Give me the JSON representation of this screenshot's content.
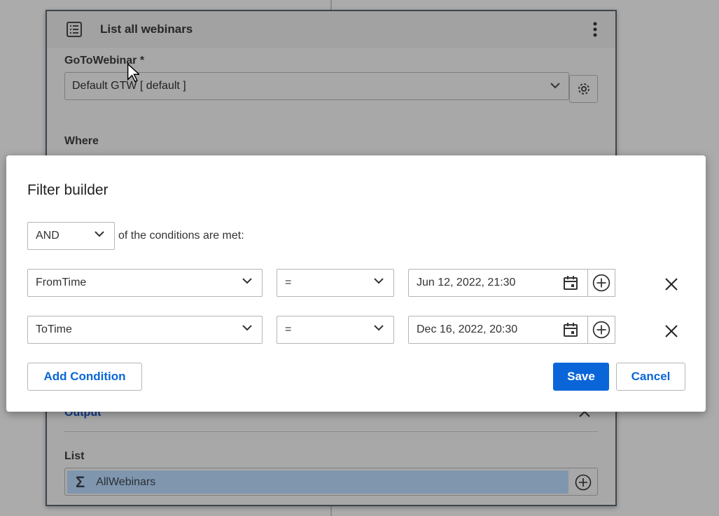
{
  "card": {
    "title": "List all webinars",
    "gtw_label": "GoToWebinar *",
    "gtw_value": "Default GTW [ default ]",
    "where_label": "Where",
    "output_label": "Output",
    "list_label": "List",
    "list_value": "AllWebinars"
  },
  "modal": {
    "title": "Filter builder",
    "logic": "AND",
    "logic_suffix": "of the conditions are met:",
    "conditions": [
      {
        "field": "FromTime",
        "operator": "=",
        "value": "Jun 12, 2022, 21:30"
      },
      {
        "field": "ToTime",
        "operator": "=",
        "value": "Dec 16, 2022, 20:30"
      }
    ],
    "add_condition": "Add Condition",
    "save": "Save",
    "cancel": "Cancel"
  },
  "colors": {
    "primary": "#0a66d8",
    "overlay": "#ababab",
    "chip": "#7f96ae"
  }
}
